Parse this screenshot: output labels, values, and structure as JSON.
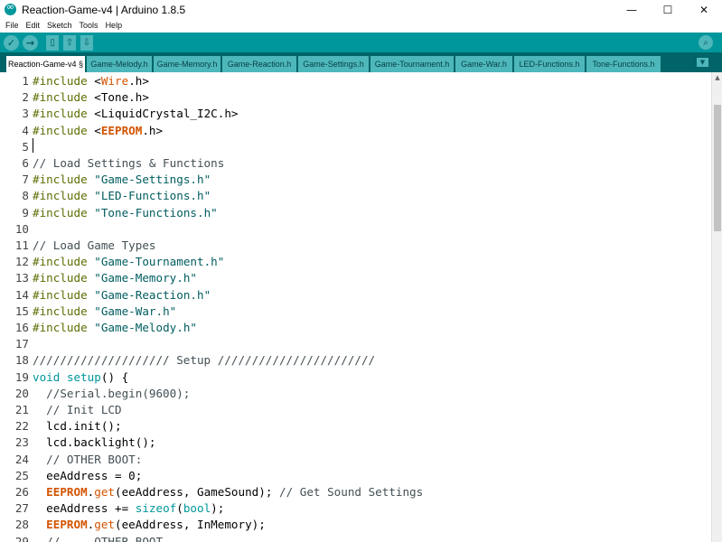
{
  "window": {
    "title": "Reaction-Game-v4 | Arduino 1.8.5",
    "minimize": "—",
    "maximize": "☐",
    "close": "✕"
  },
  "menu": [
    "File",
    "Edit",
    "Sketch",
    "Tools",
    "Help"
  ],
  "toolbar": {
    "verify": "✓",
    "upload": "→",
    "new": "▯",
    "open": "⇧",
    "save": "⇩",
    "serial_monitor": "⌕"
  },
  "tabs": [
    "Reaction-Game-v4 §",
    "Game-Melody.h",
    "Game-Memory.h",
    "Game-Reaction.h",
    "Game-Settings.h",
    "Game-Tournament.h",
    "Game-War.h",
    "LED-Functions.h",
    "Tone-Functions.h"
  ],
  "tab_menu": "▼",
  "colors": {
    "toolbar": "#00979c",
    "tabbar": "#006468",
    "keyword": "#5e6d03",
    "library": "#d35400"
  },
  "code": [
    {
      "n": "1",
      "parts": [
        [
          "kw",
          "#include"
        ],
        [
          "",
          " <"
        ],
        [
          "lib",
          "Wire"
        ],
        [
          "",
          ".h>"
        ]
      ]
    },
    {
      "n": "2",
      "parts": [
        [
          "kw",
          "#include"
        ],
        [
          "",
          " <Tone.h>"
        ]
      ]
    },
    {
      "n": "3",
      "parts": [
        [
          "kw",
          "#include"
        ],
        [
          "",
          " <LiquidCrystal_I2C.h>"
        ]
      ]
    },
    {
      "n": "4",
      "parts": [
        [
          "kw",
          "#include"
        ],
        [
          "",
          " <"
        ],
        [
          "libb",
          "EEPROM"
        ],
        [
          "",
          ".h>"
        ]
      ]
    },
    {
      "n": "5",
      "parts": []
    },
    {
      "n": "6",
      "parts": [
        [
          "cmt",
          "// Load Settings & Functions"
        ]
      ]
    },
    {
      "n": "7",
      "parts": [
        [
          "kw",
          "#include"
        ],
        [
          "",
          " "
        ],
        [
          "str",
          "\"Game-Settings.h\""
        ]
      ]
    },
    {
      "n": "8",
      "parts": [
        [
          "kw",
          "#include"
        ],
        [
          "",
          " "
        ],
        [
          "str",
          "\"LED-Functions.h\""
        ]
      ]
    },
    {
      "n": "9",
      "parts": [
        [
          "kw",
          "#include"
        ],
        [
          "",
          " "
        ],
        [
          "str",
          "\"Tone-Functions.h\""
        ]
      ]
    },
    {
      "n": "10",
      "parts": []
    },
    {
      "n": "11",
      "parts": [
        [
          "cmt",
          "// Load Game Types"
        ]
      ]
    },
    {
      "n": "12",
      "parts": [
        [
          "kw",
          "#include"
        ],
        [
          "",
          " "
        ],
        [
          "str",
          "\"Game-Tournament.h\""
        ]
      ]
    },
    {
      "n": "13",
      "parts": [
        [
          "kw",
          "#include"
        ],
        [
          "",
          " "
        ],
        [
          "str",
          "\"Game-Memory.h\""
        ]
      ]
    },
    {
      "n": "14",
      "parts": [
        [
          "kw",
          "#include"
        ],
        [
          "",
          " "
        ],
        [
          "str",
          "\"Game-Reaction.h\""
        ]
      ]
    },
    {
      "n": "15",
      "parts": [
        [
          "kw",
          "#include"
        ],
        [
          "",
          " "
        ],
        [
          "str",
          "\"Game-War.h\""
        ]
      ]
    },
    {
      "n": "16",
      "parts": [
        [
          "kw",
          "#include"
        ],
        [
          "",
          " "
        ],
        [
          "str",
          "\"Game-Melody.h\""
        ]
      ]
    },
    {
      "n": "17",
      "parts": []
    },
    {
      "n": "18",
      "parts": [
        [
          "cmt",
          "//////////////////// Setup ///////////////////////"
        ]
      ]
    },
    {
      "n": "19",
      "parts": [
        [
          "type",
          "void"
        ],
        [
          "",
          " "
        ],
        [
          "type",
          "setup"
        ],
        [
          "",
          "() {"
        ]
      ]
    },
    {
      "n": "20",
      "parts": [
        [
          "cmt",
          "  //Serial.begin(9600);"
        ]
      ]
    },
    {
      "n": "21",
      "parts": [
        [
          "cmt",
          "  // Init LCD"
        ]
      ]
    },
    {
      "n": "22",
      "parts": [
        [
          "",
          "  lcd.init();"
        ]
      ]
    },
    {
      "n": "23",
      "parts": [
        [
          "",
          "  lcd.backlight();"
        ]
      ]
    },
    {
      "n": "24",
      "parts": [
        [
          "cmt",
          "  // OTHER BOOT:"
        ]
      ]
    },
    {
      "n": "25",
      "parts": [
        [
          "",
          "  eeAddress = 0;"
        ]
      ]
    },
    {
      "n": "26",
      "parts": [
        [
          "",
          "  "
        ],
        [
          "libb",
          "EEPROM"
        ],
        [
          "",
          "."
        ],
        [
          "lib",
          "get"
        ],
        [
          "",
          "(eeAddress, GameSound); "
        ],
        [
          "cmt",
          "// Get Sound Settings"
        ]
      ]
    },
    {
      "n": "27",
      "parts": [
        [
          "",
          "  eeAddress += "
        ],
        [
          "type",
          "sizeof"
        ],
        [
          "",
          "("
        ],
        [
          "type",
          "bool"
        ],
        [
          "",
          ");"
        ]
      ]
    },
    {
      "n": "28",
      "parts": [
        [
          "",
          "  "
        ],
        [
          "libb",
          "EEPROM"
        ],
        [
          "",
          "."
        ],
        [
          "lib",
          "get"
        ],
        [
          "",
          "(eeAddress, InMemory);"
        ]
      ]
    },
    {
      "n": "29",
      "parts": [
        [
          "cmt",
          "  // ... OTHER BOOT ..."
        ]
      ]
    }
  ]
}
